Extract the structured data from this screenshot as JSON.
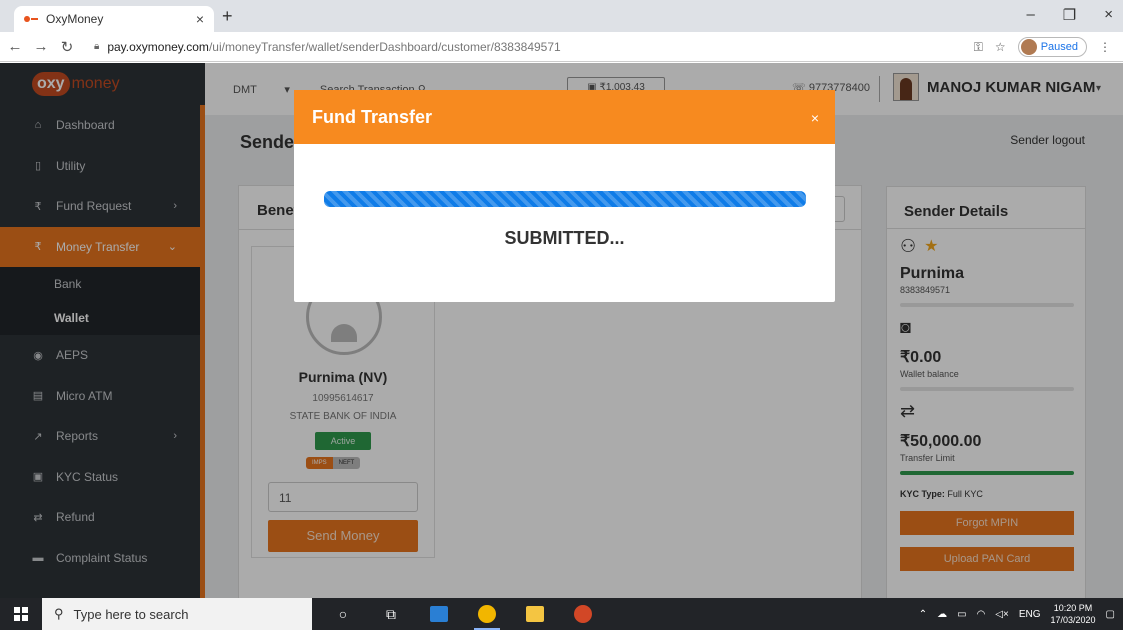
{
  "browser": {
    "tab_title": "OxyMoney",
    "tab_close": "×",
    "new_tab": "+",
    "url_host": "pay.oxymoney.com",
    "url_path": "/ui/moneyTransfer/wallet/senderDashboard/customer/8383849571",
    "profile_status": "Paused",
    "win_min": "–",
    "win_restore": "❐",
    "win_close": "×"
  },
  "app": {
    "logo_left": "oxy",
    "logo_right": "money"
  },
  "sidebar": {
    "items": [
      {
        "label": "Dashboard",
        "icon": "home-icon"
      },
      {
        "label": "Utility",
        "icon": "mobile-icon"
      },
      {
        "label": "Fund Request",
        "icon": "rupee-icon",
        "chevron": "›"
      },
      {
        "label": "Money Transfer",
        "icon": "rupee-icon",
        "chevron": "⌄"
      },
      {
        "label": "AEPS",
        "icon": "fingerprint-icon"
      },
      {
        "label": "Micro ATM",
        "icon": "atm-icon"
      },
      {
        "label": "Reports",
        "icon": "chart-icon",
        "chevron": "›"
      },
      {
        "label": "KYC Status",
        "icon": "id-card-icon"
      },
      {
        "label": "Refund",
        "icon": "refund-icon"
      },
      {
        "label": "Complaint Status",
        "icon": "complaint-icon"
      }
    ],
    "sub_items": [
      "Bank",
      "Wallet"
    ]
  },
  "topbar": {
    "mode": "DMT",
    "mode_caret": "▾",
    "search_placeholder": "Search Transaction",
    "balance": "₹1,003.43",
    "phone": "9773778400",
    "user_name": "MANOJ KUMAR NIGAM",
    "user_caret": "▾"
  },
  "page": {
    "title": "Sender",
    "sender_logout": "Sender logout",
    "beneficiary_heading": "Benefi"
  },
  "beneficiary": {
    "name": "Purnima (NV)",
    "account": "10995614617",
    "bank": "STATE BANK OF INDIA",
    "status": "Active",
    "mode_imps": "IMPS",
    "mode_neft": "NEFT",
    "amount": "11",
    "send_label": "Send Money"
  },
  "sender_details": {
    "heading": "Sender Details",
    "name": "Purnima",
    "mobile": "8383849571",
    "wallet_balance": "₹0.00",
    "wallet_balance_label": "Wallet balance",
    "transfer_limit": "₹50,000.00",
    "transfer_limit_label": "Transfer Limit",
    "kyc_label": "KYC Type:",
    "kyc_value": " Full KYC",
    "forgot_mpin": "Forgot MPIN",
    "upload_pan": "Upload PAN Card"
  },
  "modal": {
    "title": "Fund Transfer",
    "close": "×",
    "message": "SUBMITTED...",
    "progress_percent": 100
  },
  "taskbar": {
    "search_placeholder": "Type here to search",
    "language": "ENG",
    "time": "10:20 PM",
    "date": "17/03/2020"
  },
  "colors": {
    "accent": "#e8751e",
    "modal_header": "#f78a1f",
    "progress": "#0f7ce8",
    "sidebar": "#2e3338",
    "success": "#2f9a4c"
  }
}
